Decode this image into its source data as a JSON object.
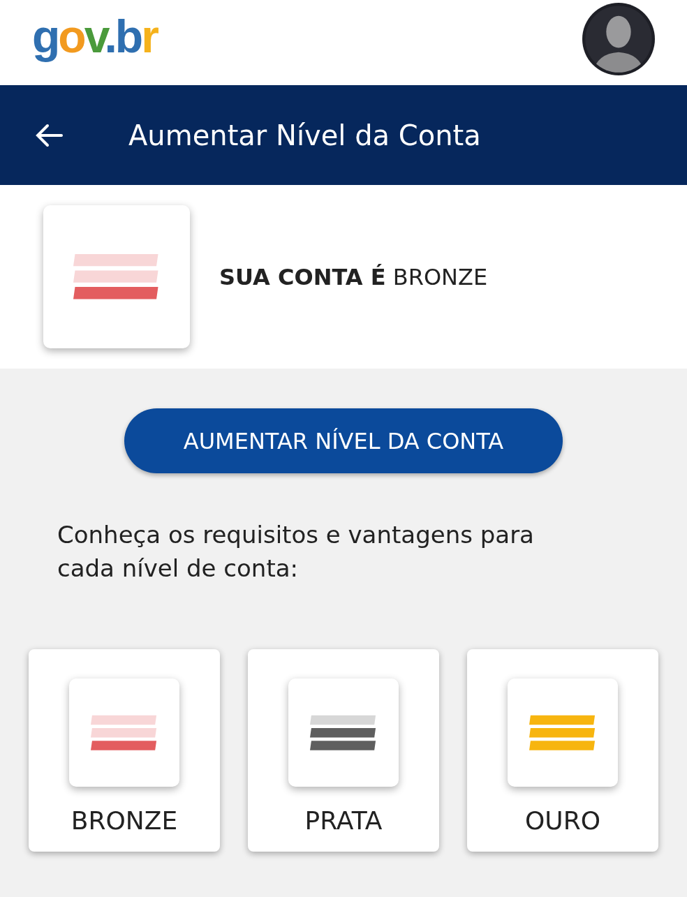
{
  "logo": [
    {
      "text": "g",
      "color": "#2f6fb0"
    },
    {
      "text": "o",
      "color": "#f29a1f"
    },
    {
      "text": "v",
      "color": "#4a9a3b"
    },
    {
      "text": ".",
      "color": "#2f6fb0"
    },
    {
      "text": "b",
      "color": "#2f6fb0"
    },
    {
      "text": "r",
      "color": "#f5b21c"
    }
  ],
  "header": {
    "title": "Aumentar Nível da Conta"
  },
  "account": {
    "text": "**SUA CONTA É** BRONZE",
    "color": "#e35d5f",
    "bars": [
      {
        "on": false
      },
      {
        "on": false
      },
      {
        "on": true
      }
    ]
  },
  "action_button": "AUMENTAR NÍVEL DA CONTA",
  "intro": "Conheça os requisitos e vantagens para cada nível de conta:",
  "levels": [
    {
      "label": "BRONZE",
      "color": "#e35d5f",
      "bars": [
        {
          "on": false
        },
        {
          "on": false
        },
        {
          "on": true
        }
      ]
    },
    {
      "label": "PRATA",
      "color": "#5f5f5f",
      "bars": [
        {
          "on": false
        },
        {
          "on": true
        },
        {
          "on": true
        }
      ]
    },
    {
      "label": "OURO",
      "color": "#f7b50f",
      "bars": [
        {
          "on": true
        },
        {
          "on": true
        },
        {
          "on": true
        }
      ]
    }
  ]
}
